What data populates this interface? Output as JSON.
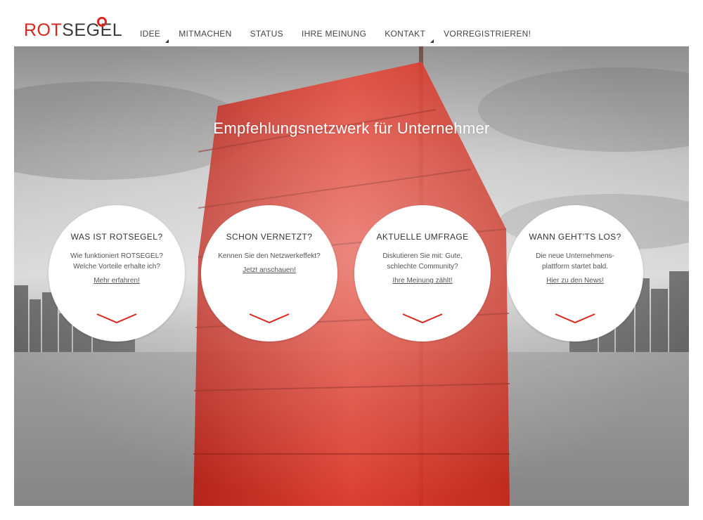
{
  "brand": {
    "part1": "ROT",
    "part2": "SEGEL",
    "accent": "#d7261c"
  },
  "nav": [
    {
      "label": "IDEE",
      "has_dropdown": true
    },
    {
      "label": "MITMACHEN",
      "has_dropdown": false
    },
    {
      "label": "STATUS",
      "has_dropdown": false
    },
    {
      "label": "IHRE MEINUNG",
      "has_dropdown": false
    },
    {
      "label": "KONTAKT",
      "has_dropdown": true
    },
    {
      "label": "VORREGISTRIEREN!",
      "has_dropdown": false
    }
  ],
  "hero": {
    "tagline": "Empfehlungsnetzwerk für Unternehmer",
    "image": "red-junk-sail-over-city-harbor"
  },
  "cards": [
    {
      "title": "WAS IST ROTSEGEL?",
      "text": "Wie funktioniert ROTSEGEL? Welche Vorteile erhalte ich?",
      "link": "Mehr erfahren!",
      "icon": "chevron-down-icon"
    },
    {
      "title": "SCHON VERNETZT?",
      "text": "Kennen Sie den Netzwerkeffekt?",
      "link": "Jetzt anschauen!",
      "icon": "chevron-down-icon"
    },
    {
      "title": "AKTUELLE UMFRAGE",
      "text": "Diskutieren Sie mit: Gute, schlechte Community?",
      "link": "Ihre Meinung zählt!",
      "icon": "chevron-down-icon"
    },
    {
      "title": "WANN GEHT'TS LOS?",
      "text": "Die neue Unternehmens-plattform startet bald.",
      "link": "Hier zu den News!",
      "icon": "chevron-down-icon"
    }
  ]
}
